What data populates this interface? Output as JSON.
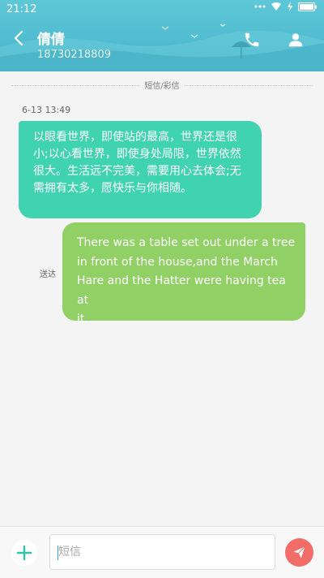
{
  "status_bar": {
    "time": "21:12",
    "icons": [
      "signal-dots-icon",
      "wifi-icon",
      "charging-icon",
      "battery-icon"
    ]
  },
  "header": {
    "contact_name": "倩倩",
    "contact_number": "18730218809",
    "icons": [
      "back-arrow-icon",
      "phone-icon",
      "person-icon"
    ]
  },
  "conversation": {
    "channel_label": "短信/彩信",
    "timestamp": "6-13 13:49",
    "messages": [
      {
        "direction": "incoming",
        "lines": [
          "以眼看世界，即使站的最高，世界还是很",
          "小;以心看世界，即使身处局限，世界依然",
          "很大。生活远不完美，需要用心去体会;无",
          "需拥有太多，愿快乐与你相随。"
        ]
      },
      {
        "direction": "outgoing",
        "status": "送达",
        "lines": [
          "There was a table set out under a tree",
          "in front of the house,and the March",
          "Hare and the Hatter were having tea at",
          "it."
        ]
      }
    ]
  },
  "composer": {
    "placeholder": "短信",
    "value": "",
    "icons": [
      "plus-icon",
      "send-icon"
    ]
  },
  "colors": {
    "header": "#52bdd1",
    "incoming_bubble": "#3fd3b0",
    "outgoing_bubble": "#91d065",
    "send_button": "#f26d68",
    "accent": "#2ec4a6"
  }
}
